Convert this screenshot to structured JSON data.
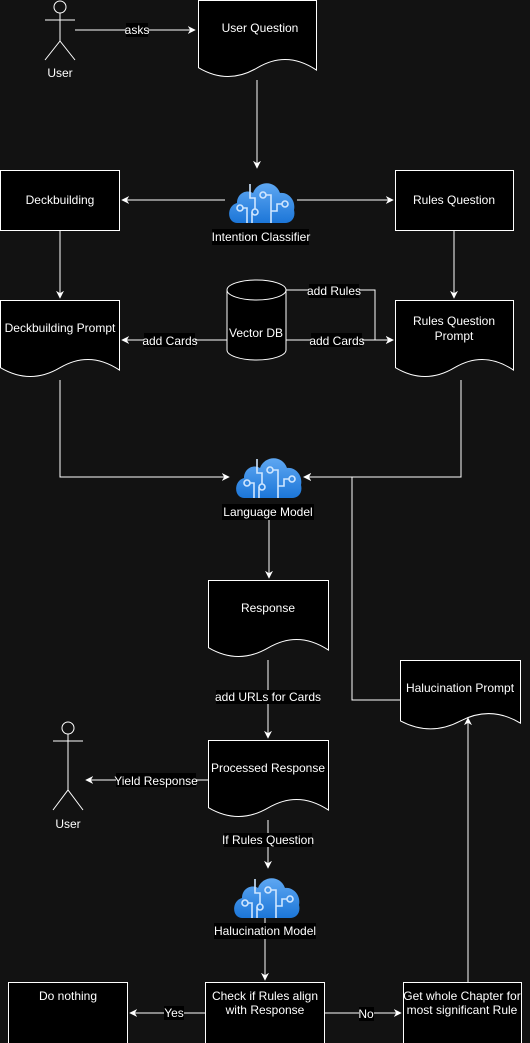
{
  "colors": {
    "background": "#121212",
    "node_fill": "#000000",
    "stroke": "#ffffff",
    "cloud_light": "#5ea7f2",
    "cloud_dark": "#1c76d8"
  },
  "nodes": {
    "user_top": "User",
    "user_question": "User Question",
    "intention_classifier": "Intention Classifier",
    "deckbuilding": "Deckbuilding",
    "rules_question": "Rules Question",
    "deckbuilding_prompt": "Deckbuilding Prompt",
    "vector_db": "Vector DB",
    "rules_question_prompt": [
      "Rules Question",
      "Prompt"
    ],
    "language_model": "Language Model",
    "response": "Response",
    "halucination_prompt": "Halucination Prompt",
    "processed_response": "Processed Response",
    "user_bottom": "User",
    "halucination_model": "Halucination Model",
    "do_nothing": "Do nothing",
    "check_rules": [
      "Check if Rules align",
      "with Response"
    ],
    "get_chapter": [
      "Get whole Chapter for",
      "most significant Rule"
    ]
  },
  "edges": {
    "asks": "asks",
    "add_cards_left": "add Cards",
    "add_cards_right": "add Cards",
    "add_rules": "add Rules",
    "add_urls": "add URLs for Cards",
    "yield_response": "Yield Response",
    "if_rules_question": "If Rules Question",
    "yes": "Yes",
    "no": "No"
  },
  "icons": {
    "actor": "stick-figure-icon",
    "model": "cloud-ai-circuit-icon",
    "database": "cylinder-database-icon"
  }
}
